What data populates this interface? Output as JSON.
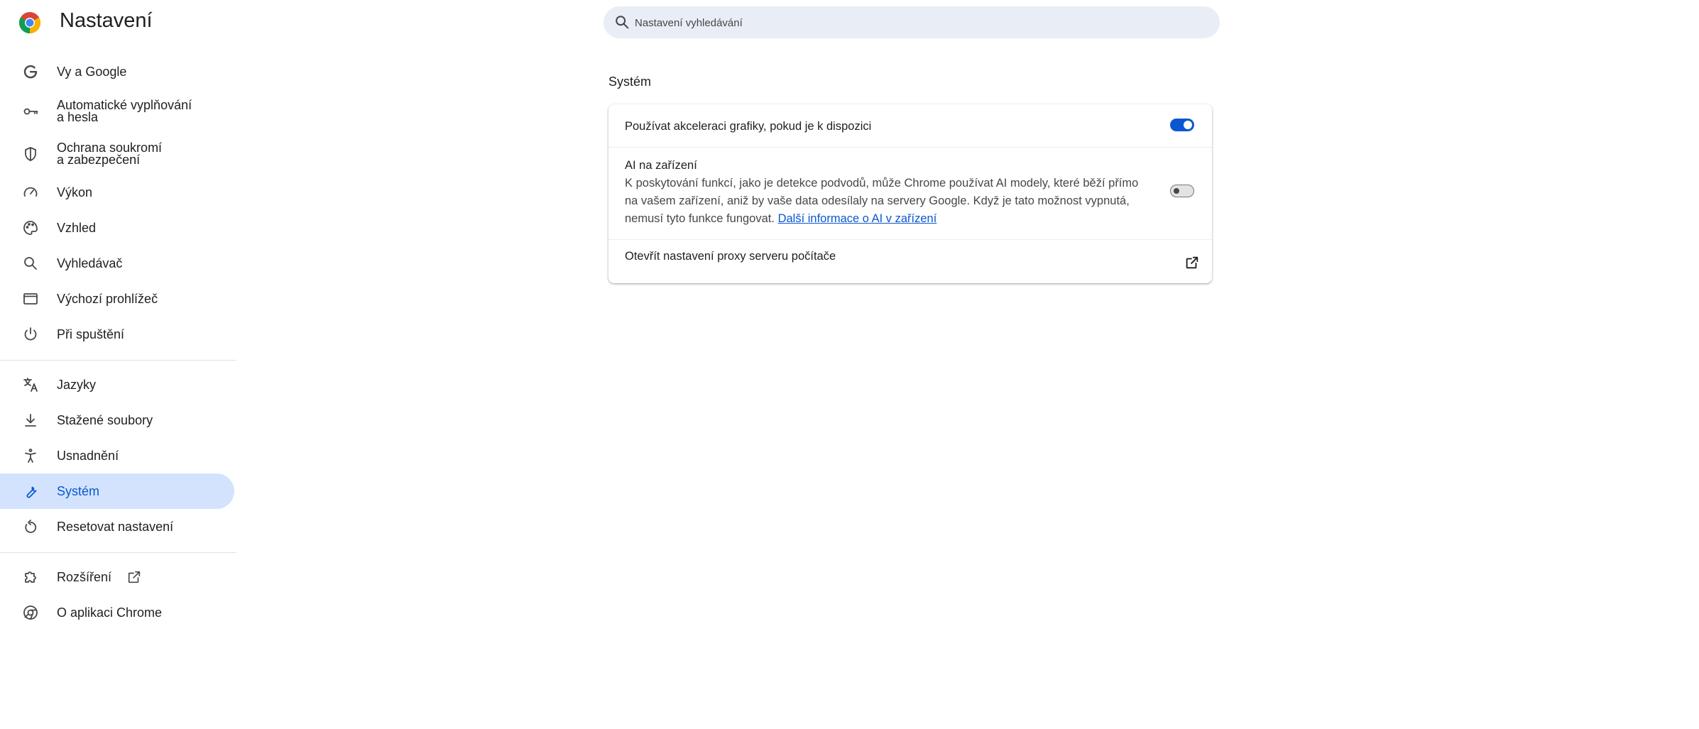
{
  "app": {
    "title": "Nastavení",
    "logo_icon": "chrome-logo-icon"
  },
  "search": {
    "placeholder": "Nastavení vyhledávání",
    "icon": "search-icon"
  },
  "sidebar": {
    "items": [
      {
        "label": "Vy a Google",
        "icon": "google-g-icon"
      },
      {
        "label": "Automatické vyplňování\na hesla",
        "icon": "key-icon"
      },
      {
        "label": "Ochrana soukromí\na zabezpečení",
        "icon": "shield-icon"
      },
      {
        "label": "Výkon",
        "icon": "speedometer-icon"
      },
      {
        "label": "Vzhled",
        "icon": "palette-icon"
      },
      {
        "label": "Vyhledávač",
        "icon": "search-icon"
      },
      {
        "label": "Výchozí prohlížeč",
        "icon": "browser-window-icon"
      },
      {
        "label": "Při spuštění",
        "icon": "power-icon"
      },
      {
        "label": "Jazyky",
        "icon": "translate-icon"
      },
      {
        "label": "Stažené soubory",
        "icon": "download-icon"
      },
      {
        "label": "Usnadnění",
        "icon": "accessibility-icon"
      },
      {
        "label": "Systém",
        "icon": "wrench-icon",
        "active": true
      },
      {
        "label": "Resetovat nastavení",
        "icon": "reset-icon"
      },
      {
        "label": "Rozšíření",
        "icon": "puzzle-icon",
        "external_icon": "open-in-new-icon"
      },
      {
        "label": "O aplikaci Chrome",
        "icon": "chrome-icon"
      }
    ]
  },
  "main": {
    "section_title": "Systém",
    "rows": [
      {
        "label": "Používat akceleraci grafiky, pokud je k dispozici",
        "toggle": true
      },
      {
        "label": "AI na zařízení",
        "description": "K poskytování funkcí, jako je detekce podvodů, může Chrome používat AI modely, které běží přímo na vašem zařízení, aniž by vaše data odesílaly na servery Google. Když je tato možnost vypnutá, nemusí tyto funkce fungovat.",
        "link": "Další informace o AI v zařízení",
        "toggle": false
      },
      {
        "label": "Otevřít nastavení proxy serveru počítače",
        "icon": "open-in-new-icon"
      }
    ]
  },
  "colors": {
    "accent": "#0b57d0",
    "active_bg": "#d3e3fd",
    "search_bg": "#e9edf5"
  }
}
